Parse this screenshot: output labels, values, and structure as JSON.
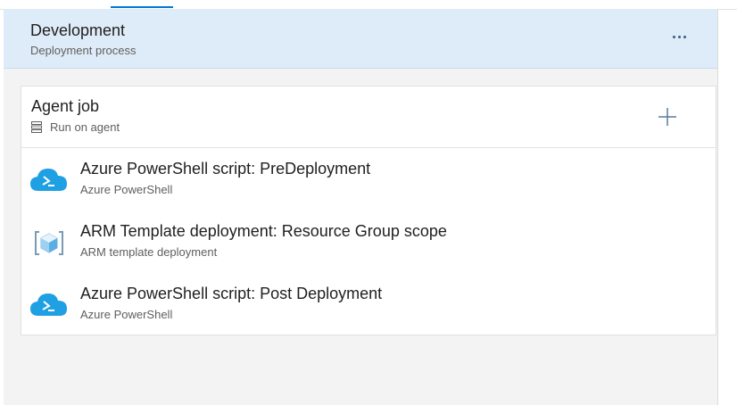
{
  "stage": {
    "title": "Development",
    "subtitle": "Deployment process",
    "more_icon": "ellipsis-icon"
  },
  "agent_job": {
    "title": "Agent job",
    "subtitle": "Run on agent",
    "icon": "server-icon",
    "add_icon": "plus-icon"
  },
  "tasks": [
    {
      "title": "Azure PowerShell script: PreDeployment",
      "subtitle": "Azure PowerShell",
      "icon": "azure-powershell-icon"
    },
    {
      "title": "ARM Template deployment: Resource Group scope",
      "subtitle": "ARM template deployment",
      "icon": "arm-template-icon"
    },
    {
      "title": "Azure PowerShell script: Post Deployment",
      "subtitle": "Azure PowerShell",
      "icon": "azure-powershell-icon"
    }
  ],
  "colors": {
    "stage_header_bg": "#deecf9",
    "panel_bg": "#f3f3f3",
    "azure_blue": "#1ea0e3",
    "accent": "#0078d4"
  }
}
